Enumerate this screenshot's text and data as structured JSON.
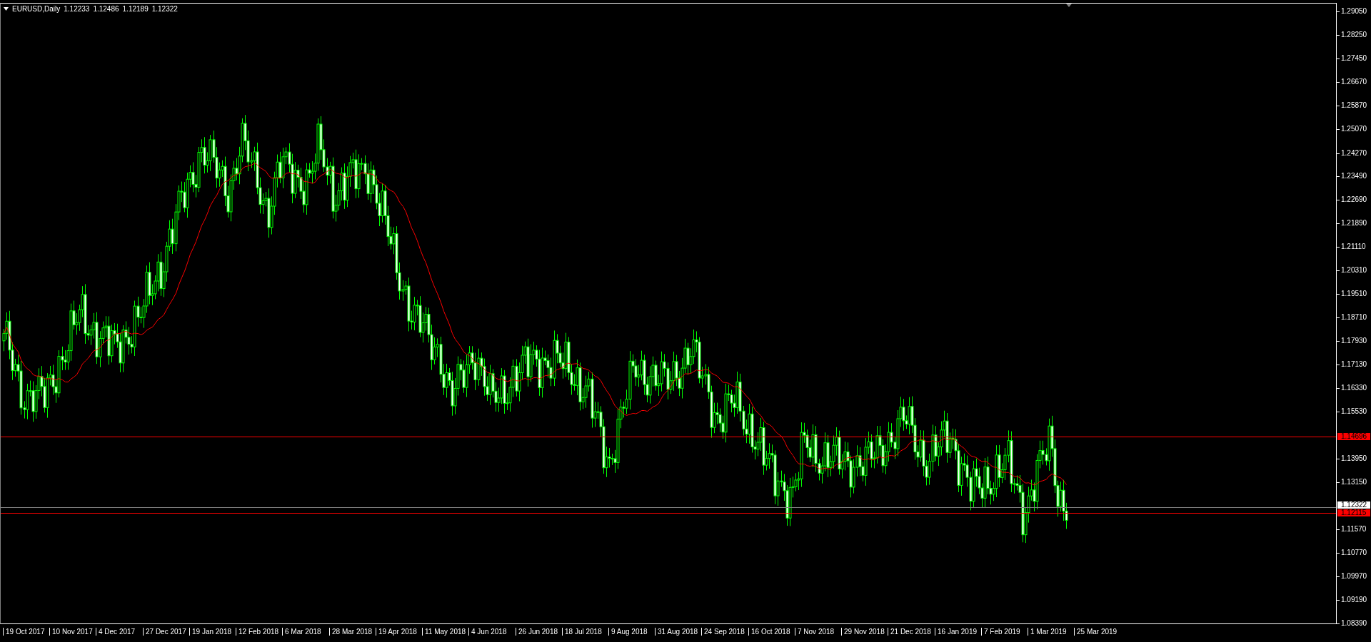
{
  "chart": {
    "symbol": "EURUSD,Daily",
    "quotes": [
      "1.12233",
      "1.12486",
      "1.12189",
      "1.12322"
    ],
    "price_axis": [
      "1.29050",
      "1.28250",
      "1.27450",
      "1.26670",
      "1.25870",
      "1.25070",
      "1.24270",
      "1.23490",
      "1.22690",
      "1.21890",
      "1.21110",
      "1.20310",
      "1.19510",
      "1.18710",
      "1.17930",
      "1.17130",
      "1.16330",
      "1.15530",
      "1.13950",
      "1.13150",
      "1.11570",
      "1.10770",
      "1.09970",
      "1.09190",
      "1.08390"
    ],
    "levels": [
      {
        "kind": "level",
        "label": "1.14696",
        "color": "#ff0000"
      },
      {
        "kind": "bid",
        "label": "1.12322"
      },
      {
        "kind": "level",
        "label": "1.12115",
        "color": "#ff0000"
      }
    ],
    "time_axis": [
      "19 Oct 2017",
      "10 Nov 2017",
      "4 Dec 2017",
      "27 Dec 2017",
      "19 Jan 2018",
      "12 Feb 2018",
      "6 Mar 2018",
      "28 Mar 2018",
      "19 Apr 2018",
      "11 May 2018",
      "4 Jun 2018",
      "26 Jun 2018",
      "18 Jul 2018",
      "9 Aug 2018",
      "31 Aug 2018",
      "24 Sep 2018",
      "16 Oct 2018",
      "7 Nov 2018",
      "29 Nov 2018",
      "21 Dec 2018",
      "16 Jan 2019",
      "7 Feb 2019",
      "1 Mar 2019",
      "25 Mar 2019"
    ]
  }
}
